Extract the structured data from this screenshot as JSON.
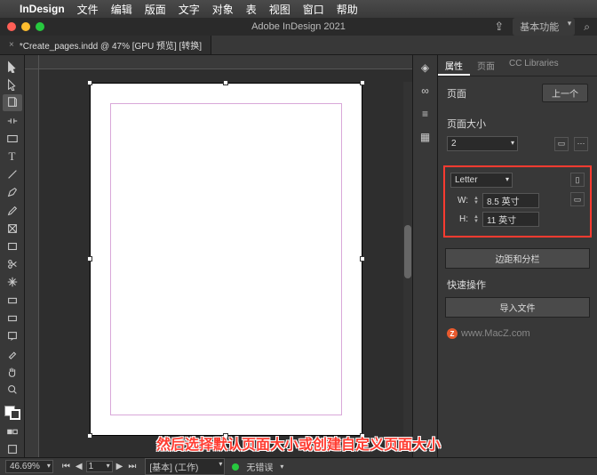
{
  "menubar": {
    "app": "InDesign",
    "items": [
      "文件",
      "编辑",
      "版面",
      "文字",
      "对象",
      "表",
      "视图",
      "窗口",
      "帮助"
    ]
  },
  "titlebar": {
    "title": "Adobe InDesign 2021",
    "workspace": "基本功能"
  },
  "tab": {
    "label": "*Create_pages.indd @ 47% [GPU 预览] [转换]"
  },
  "panel": {
    "tabs": {
      "properties": "属性",
      "pages": "页面",
      "cc": "CC Libraries"
    },
    "page_label": "页面",
    "prev_btn": "上一个",
    "size_label": "页面大小",
    "page_num": "2",
    "preset": "Letter",
    "w_label": "W:",
    "w_value": "8.5 英寸",
    "h_label": "H:",
    "h_value": "11 英寸",
    "margins_btn": "边距和分栏",
    "quick_label": "快速操作",
    "import_btn": "导入文件"
  },
  "watermark": "www.MacZ.com",
  "status": {
    "zoom": "46.69%",
    "page": "1",
    "workspace": "[基本] (工作)",
    "errors": "无错误"
  },
  "caption": "然后选择默认页面大小或创建自定义页面大小"
}
